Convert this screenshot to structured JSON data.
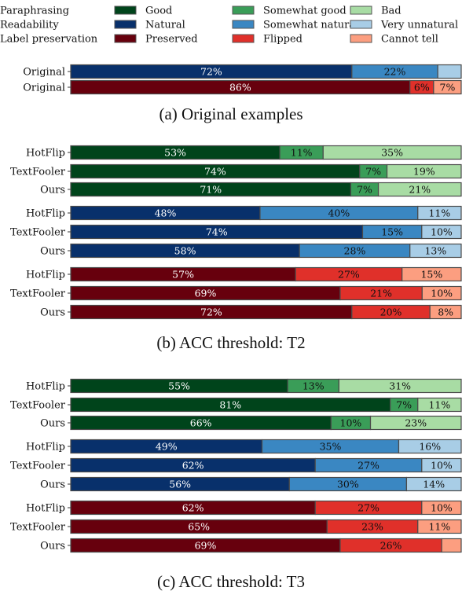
{
  "chart_data": {
    "type": "bar",
    "orientation": "horizontal-stacked-100",
    "legend": {
      "position": "top",
      "groups": [
        {
          "name": "Paraphrasing",
          "items": [
            {
              "label": "Good",
              "color": "#00441b"
            },
            {
              "label": "Somewhat good",
              "color": "#3a9d58"
            },
            {
              "label": "Bad",
              "color": "#a8dca4"
            }
          ]
        },
        {
          "name": "Readability",
          "items": [
            {
              "label": "Natural",
              "color": "#08306b"
            },
            {
              "label": "Somewhat natural",
              "color": "#3a87c2"
            },
            {
              "label": "Very unnatural",
              "color": "#a8cde6"
            }
          ]
        },
        {
          "name": "Label preservation",
          "items": [
            {
              "label": "Preserved",
              "color": "#67000d"
            },
            {
              "label": "Flipped",
              "color": "#e0302a"
            },
            {
              "label": "Cannot tell",
              "color": "#fc9e80"
            }
          ]
        }
      ]
    },
    "panels": [
      {
        "caption": "(a) Original examples",
        "groups": [
          {
            "metric": "Readability",
            "rows": [
              {
                "category": "Original",
                "values": [
                  72,
                  22,
                  6
                ],
                "labels": [
                  "72%",
                  "22%",
                  ""
                ]
              }
            ]
          },
          {
            "metric": "Label preservation",
            "rows": [
              {
                "category": "Original",
                "values": [
                  86,
                  6,
                  7
                ],
                "labels": [
                  "86%",
                  "6%",
                  "7%"
                ]
              }
            ]
          }
        ]
      },
      {
        "caption": "(b) ACC threshold: T2",
        "groups": [
          {
            "metric": "Paraphrasing",
            "rows": [
              {
                "category": "HotFlip",
                "values": [
                  53,
                  11,
                  35
                ],
                "labels": [
                  "53%",
                  "11%",
                  "35%"
                ]
              },
              {
                "category": "TextFooler",
                "values": [
                  74,
                  7,
                  19
                ],
                "labels": [
                  "74%",
                  "7%",
                  "19%"
                ]
              },
              {
                "category": "Ours",
                "values": [
                  71,
                  7,
                  21
                ],
                "labels": [
                  "71%",
                  "7%",
                  "21%"
                ]
              }
            ]
          },
          {
            "metric": "Readability",
            "rows": [
              {
                "category": "HotFlip",
                "values": [
                  48,
                  40,
                  11
                ],
                "labels": [
                  "48%",
                  "40%",
                  "11%"
                ]
              },
              {
                "category": "TextFooler",
                "values": [
                  74,
                  15,
                  10
                ],
                "labels": [
                  "74%",
                  "15%",
                  "10%"
                ]
              },
              {
                "category": "Ours",
                "values": [
                  58,
                  28,
                  13
                ],
                "labels": [
                  "58%",
                  "28%",
                  "13%"
                ]
              }
            ]
          },
          {
            "metric": "Label preservation",
            "rows": [
              {
                "category": "HotFlip",
                "values": [
                  57,
                  27,
                  15
                ],
                "labels": [
                  "57%",
                  "27%",
                  "15%"
                ]
              },
              {
                "category": "TextFooler",
                "values": [
                  69,
                  21,
                  10
                ],
                "labels": [
                  "69%",
                  "21%",
                  "10%"
                ]
              },
              {
                "category": "Ours",
                "values": [
                  72,
                  20,
                  8
                ],
                "labels": [
                  "72%",
                  "20%",
                  "8%"
                ]
              }
            ]
          }
        ]
      },
      {
        "caption": "(c) ACC threshold: T3",
        "groups": [
          {
            "metric": "Paraphrasing",
            "rows": [
              {
                "category": "HotFlip",
                "values": [
                  55,
                  13,
                  31
                ],
                "labels": [
                  "55%",
                  "13%",
                  "31%"
                ]
              },
              {
                "category": "TextFooler",
                "values": [
                  81,
                  7,
                  11
                ],
                "labels": [
                  "81%",
                  "7%",
                  "11%"
                ]
              },
              {
                "category": "Ours",
                "values": [
                  66,
                  10,
                  23
                ],
                "labels": [
                  "66%",
                  "10%",
                  "23%"
                ]
              }
            ]
          },
          {
            "metric": "Readability",
            "rows": [
              {
                "category": "HotFlip",
                "values": [
                  49,
                  35,
                  16
                ],
                "labels": [
                  "49%",
                  "35%",
                  "16%"
                ]
              },
              {
                "category": "TextFooler",
                "values": [
                  62,
                  27,
                  10
                ],
                "labels": [
                  "62%",
                  "27%",
                  "10%"
                ]
              },
              {
                "category": "Ours",
                "values": [
                  56,
                  30,
                  14
                ],
                "labels": [
                  "56%",
                  "30%",
                  "14%"
                ]
              }
            ]
          },
          {
            "metric": "Label preservation",
            "rows": [
              {
                "category": "HotFlip",
                "values": [
                  62,
                  27,
                  10
                ],
                "labels": [
                  "62%",
                  "27%",
                  "10%"
                ]
              },
              {
                "category": "TextFooler",
                "values": [
                  65,
                  23,
                  11
                ],
                "labels": [
                  "65%",
                  "23%",
                  "11%"
                ]
              },
              {
                "category": "Ours",
                "values": [
                  69,
                  26,
                  5
                ],
                "labels": [
                  "69%",
                  "26%",
                  ""
                ]
              }
            ]
          }
        ]
      }
    ],
    "xlim": [
      0,
      100
    ],
    "grid": false
  }
}
